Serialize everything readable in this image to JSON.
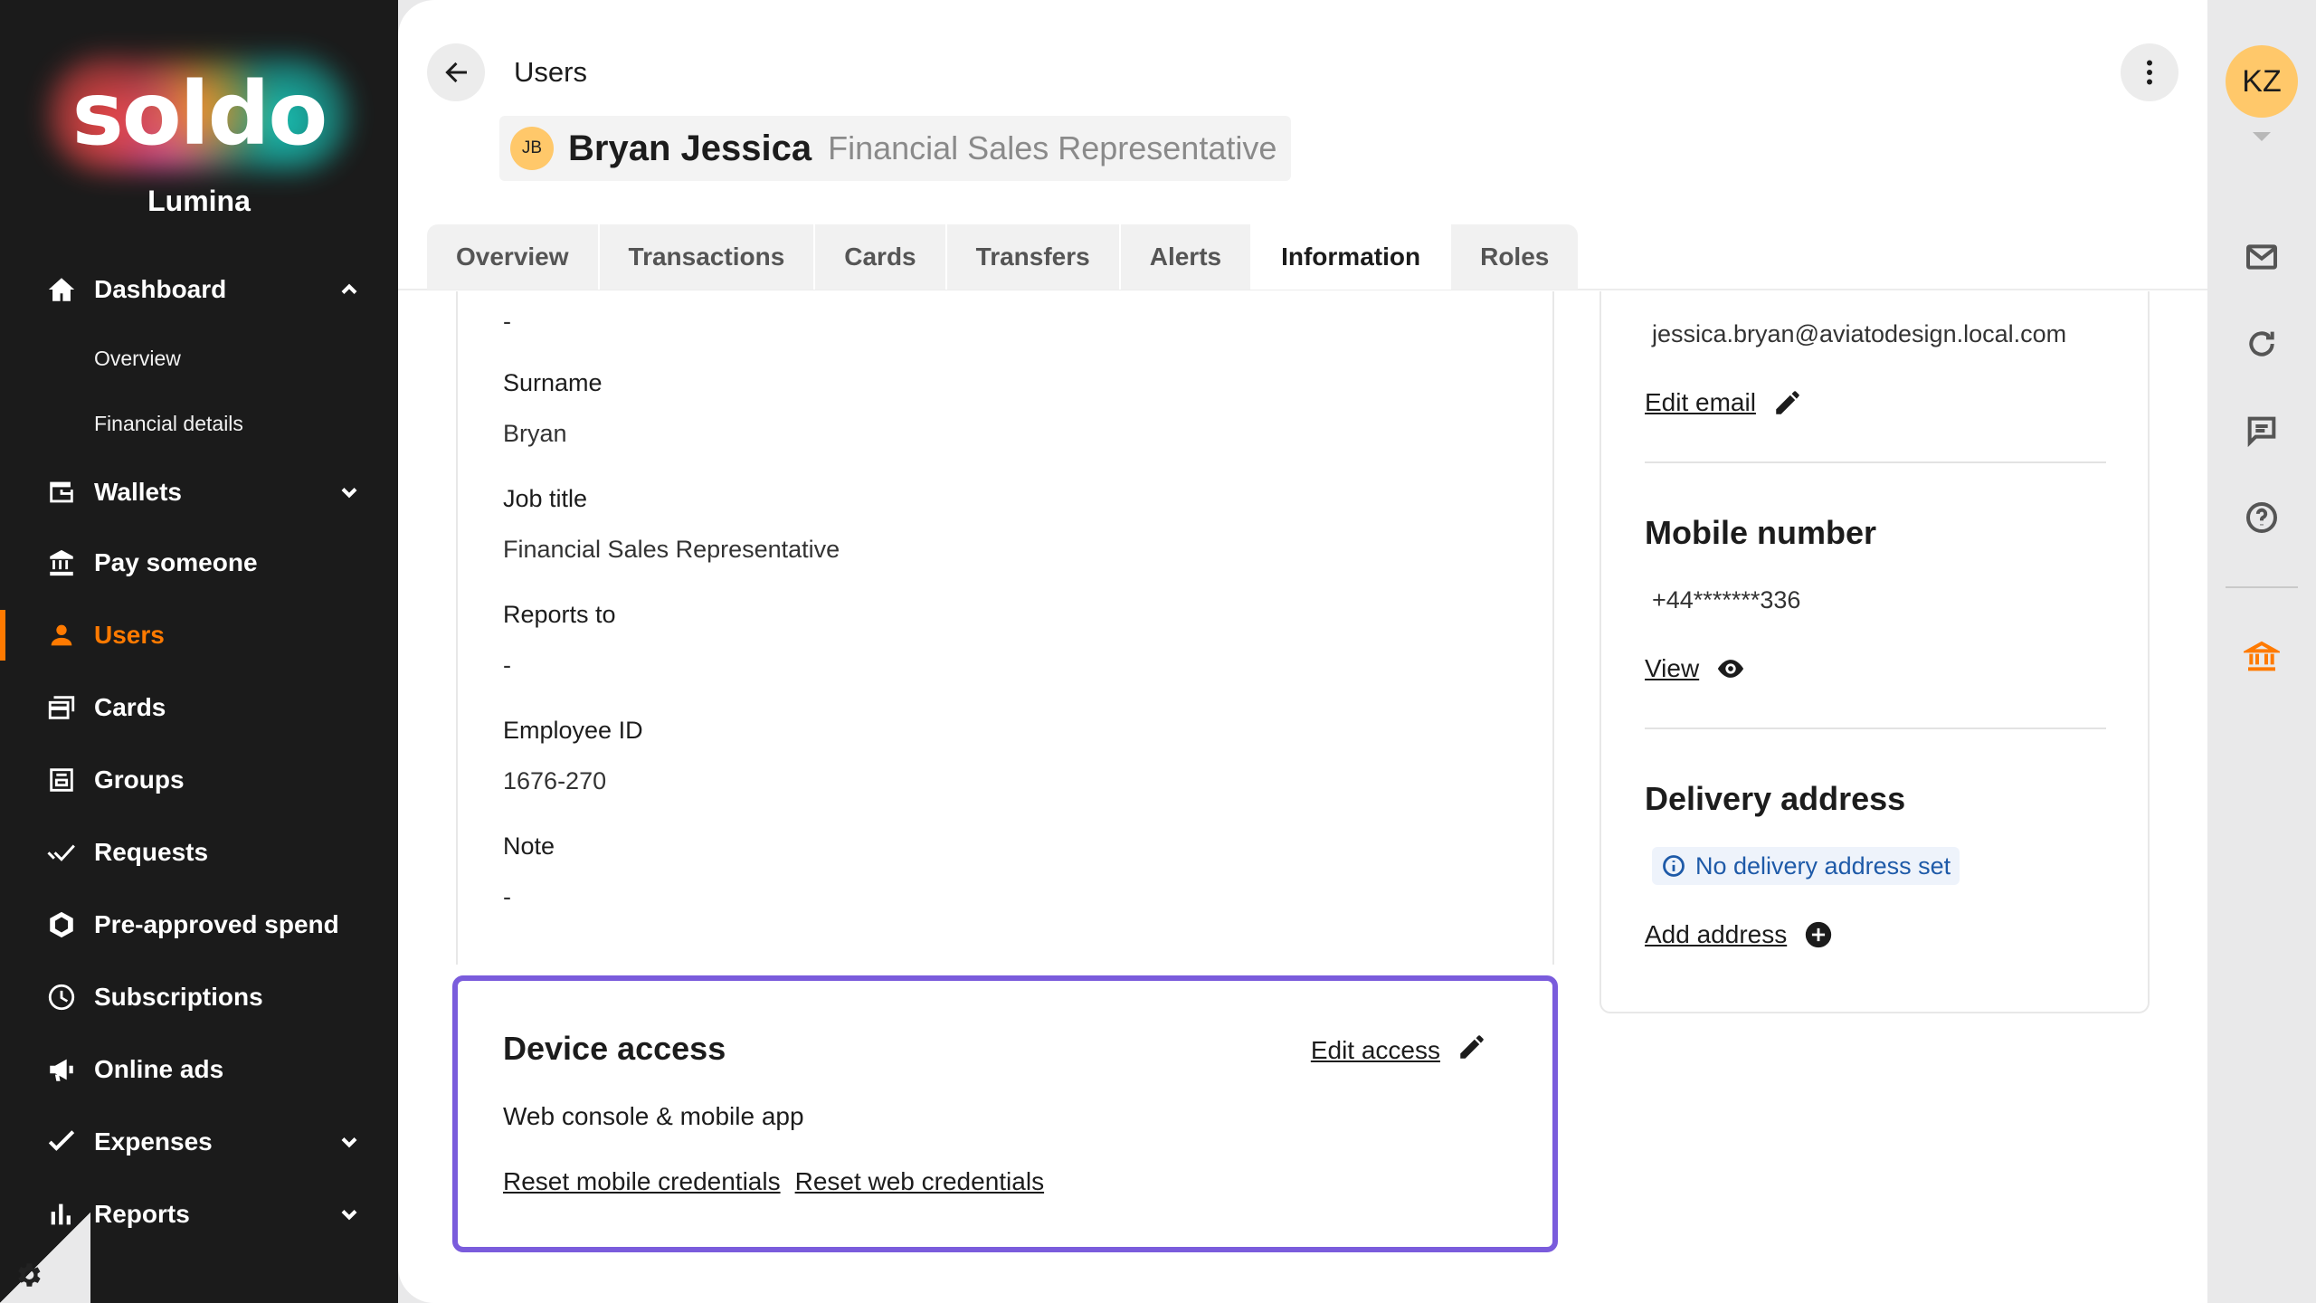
{
  "sidebar": {
    "logo_text": "soldo",
    "company": "Lumina",
    "nav": {
      "dashboard": "Dashboard",
      "overview": "Overview",
      "financial_details": "Financial details",
      "wallets": "Wallets",
      "pay_someone": "Pay someone",
      "users": "Users",
      "cards": "Cards",
      "groups": "Groups",
      "requests": "Requests",
      "pre_approved_spend": "Pre-approved spend",
      "subscriptions": "Subscriptions",
      "online_ads": "Online ads",
      "expenses": "Expenses",
      "reports": "Reports"
    },
    "active_item": "Users",
    "accent_color": "#ff7a00"
  },
  "header": {
    "breadcrumb": "Users",
    "user_initials": "JB",
    "user_name": "Bryan Jessica",
    "user_role": "Financial Sales Representative"
  },
  "tabs": [
    "Overview",
    "Transactions",
    "Cards",
    "Transfers",
    "Alerts",
    "Information",
    "Roles"
  ],
  "active_tab": "Information",
  "details": {
    "top_value": "-",
    "surname_label": "Surname",
    "surname_value": "Bryan",
    "job_title_label": "Job title",
    "job_title_value": "Financial Sales Representative",
    "reports_to_label": "Reports to",
    "reports_to_value": "-",
    "employee_id_label": "Employee ID",
    "employee_id_value": "1676-270",
    "note_label": "Note",
    "note_value": "-"
  },
  "device_access": {
    "title": "Device access",
    "edit_label": "Edit access",
    "value": "Web console & mobile app",
    "reset_mobile": "Reset mobile credentials",
    "reset_web": "Reset web credentials",
    "highlight_color": "#7a5cdc"
  },
  "contact": {
    "email": "jessica.bryan@aviatodesign.local.com",
    "edit_email": "Edit email",
    "mobile_heading": "Mobile number",
    "mobile_value": "+44*******336",
    "view_label": "View",
    "delivery_heading": "Delivery address",
    "no_address": "No delivery address set",
    "add_address": "Add address"
  },
  "rail": {
    "avatar_initials": "KZ",
    "icons": [
      "mail-icon",
      "refresh-icon",
      "chat-icon",
      "help-icon",
      "bank-icon"
    ]
  }
}
